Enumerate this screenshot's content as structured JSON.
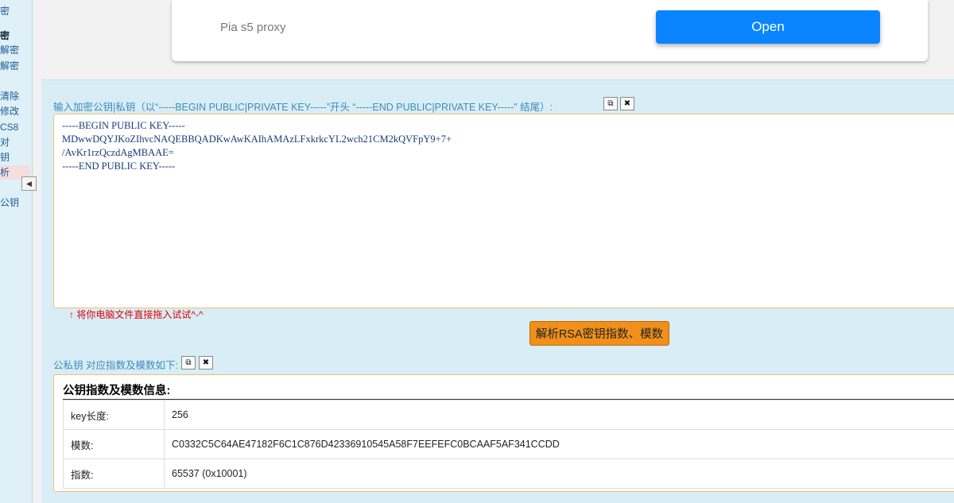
{
  "sidebar": {
    "items": [
      {
        "label": "密",
        "style": ""
      },
      {
        "label": "密",
        "style": "bold"
      },
      {
        "label": "解密",
        "style": ""
      },
      {
        "label": "解密",
        "style": ""
      },
      {
        "label": "清除",
        "style": ""
      },
      {
        "label": "修改",
        "style": ""
      },
      {
        "label": "CS8",
        "style": ""
      },
      {
        "label": "对",
        "style": ""
      },
      {
        "label": "钥",
        "style": ""
      },
      {
        "label": "析",
        "style": "hl"
      },
      {
        "label": "公钥",
        "style": ""
      }
    ],
    "collapse_icon": "triangle-left-icon"
  },
  "ad": {
    "text": "Pia s5 proxy",
    "button": "Open"
  },
  "input_section": {
    "label": "输入加密公钥|私钥（以“-----BEGIN PUBLIC|PRIVATE KEY-----”开头 “-----END PUBLIC|PRIVATE KEY-----” 结尾）:",
    "value": "-----BEGIN PUBLIC KEY-----\nMDwwDQYJKoZIhvcNAQEBBQADKwAwKAIhAMAzLFxkrkcYL2wch21CM2kQVFpY9+7+\n/AvKr1rzQczdAgMBAAE=\n-----END PUBLIC KEY-----",
    "hint": "↑ 将你电脑文件直接拖入试试^-^"
  },
  "parse_button": "解析RSA密钥指数、模数",
  "output_section": {
    "label": "公私钥 对应指数及模数如下:",
    "title": "公钥指数及模数信息:",
    "rows": [
      {
        "key": "key长度:",
        "value": "256"
      },
      {
        "key": "模数:",
        "value": "C0332C5C64AE47182F6C1C876D42336910545A58F7EEFEFC0BCAAF5AF341CCDD"
      },
      {
        "key": "指数:",
        "value": "65537 (0x10001)"
      }
    ]
  }
}
